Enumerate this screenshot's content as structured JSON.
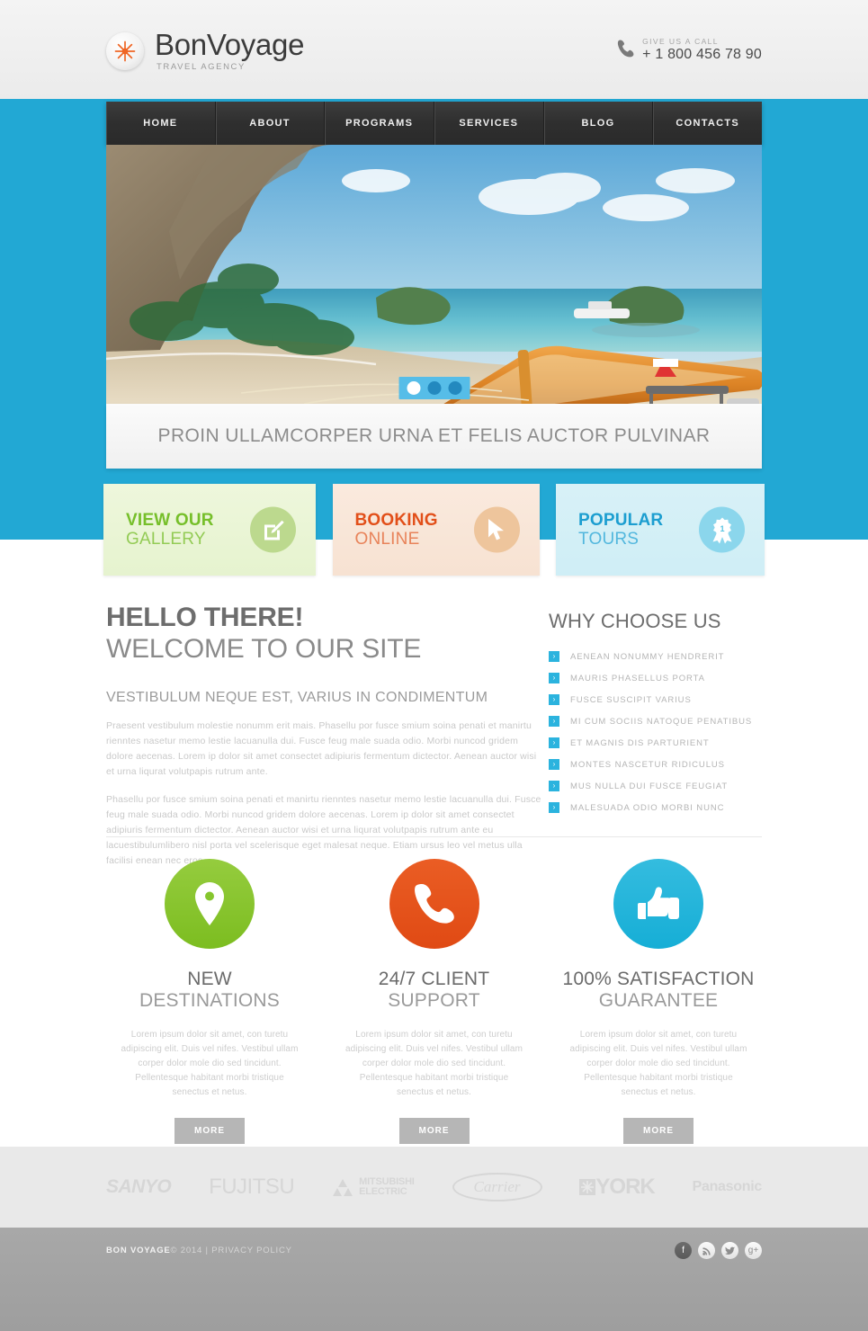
{
  "header": {
    "logo": {
      "name_bold": "Bon",
      "name_light": "Voyage",
      "tagline": "TRAVEL AGENCY",
      "icon": "starburst-icon"
    },
    "phone": {
      "label": "GIVE US A CALL",
      "number": "+ 1 800 456 78 90",
      "icon": "phone-icon"
    }
  },
  "nav": {
    "items": [
      {
        "label": "HOME"
      },
      {
        "label": "ABOUT"
      },
      {
        "label": "PROGRAMS"
      },
      {
        "label": "SERVICES"
      },
      {
        "label": "BLOG"
      },
      {
        "label": "CONTACTS"
      }
    ]
  },
  "slider": {
    "caption": "PROIN ULLAMCORPER URNA ET FELIS  AUCTOR PULVINAR",
    "dots": [
      {
        "active": true
      },
      {
        "active": false
      },
      {
        "active": false
      }
    ],
    "image_alt": "long-tail boat on tropical beach with limestone cliffs"
  },
  "promos": [
    {
      "line1": "VIEW OUR",
      "line2": "GALLERY",
      "icon": "pencil-edit-icon",
      "color": "#76bf2a"
    },
    {
      "line1": "BOOKING",
      "line2": "ONLINE",
      "icon": "cursor-arrow-icon",
      "color": "#e24f19"
    },
    {
      "line1": "POPULAR",
      "line2": "TOURS",
      "icon": "award-ribbon-icon",
      "badge_number": "1",
      "color": "#1c9ed0"
    }
  ],
  "intro": {
    "heading_bold": "HELLO THERE!",
    "heading_light": "WELCOME TO OUR SITE",
    "subheading": "VESTIBULUM NEQUE EST, VARIUS IN CONDIMENTUM",
    "paragraph1": "Praesent vestibulum molestie nonumm erit mais. Phasellu por fusce smium soina penati et manirtu rienntes nasetur memo lestie lacuanulla dui. Fusce feug male suada odio. Morbi nuncod gridem dolore aecenas. Lorem ip dolor sit amet consectet adipiuris fermentum dictector. Aenean auctor wisi et urna liqurat volutpapis rutrum ante.",
    "paragraph2": "Phasellu por fusce smium soina penati et manirtu rienntes nasetur memo lestie lacuanulla dui. Fusce feug male suada odio. Morbi nuncod gridem dolore aecenas. Lorem ip dolor sit amet consectet adipiuris fermentum dictector. Aenean auctor wisi et urna liqurat volutpapis rutrum ante eu lacuestibulumlibero nisl porta vel scelerisque eget malesat neque. Etiam ursus leo vel metus ulla facilisi enean nec eros."
  },
  "why_choose_us": {
    "title": "WHY CHOOSE US",
    "bullet_icon": "chevron-right-icon",
    "bullet_glyph": "›",
    "items": [
      {
        "label": "AENEAN NONUMMY HENDRERIT"
      },
      {
        "label": "MAURIS PHASELLUS PORTA"
      },
      {
        "label": "FUSCE SUSCIPIT VARIUS"
      },
      {
        "label": "MI CUM SOCIIS NATOQUE PENATIBUS"
      },
      {
        "label": "ET MAGNIS DIS PARTURIENT"
      },
      {
        "label": "MONTES NASCETUR RIDICULUS"
      },
      {
        "label": "MUS NULLA DUI FUSCE FEUGIAT"
      },
      {
        "label": " MALESUADA ODIO MORBI NUNC"
      }
    ]
  },
  "features": [
    {
      "icon": "map-pin-icon",
      "color": "#7cbd20",
      "title1": "NEW",
      "title2": "DESTINATIONS",
      "text": "Lorem ipsum dolor sit amet, con turetu adipiscing elit. Duis vel nifes. Vestibul ullam corper dolor mole dio sed tincidunt. Pellentesque habitant morbi tristique senectus et netus.",
      "button": "MORE"
    },
    {
      "icon": "phone-handset-icon",
      "color": "#e04a14",
      "title1": "24/7 CLIENT",
      "title2": "SUPPORT",
      "text": "Lorem ipsum dolor sit amet, con turetu adipiscing elit. Duis vel nifes. Vestibul ullam corper dolor mole dio sed tincidunt. Pellentesque habitant morbi tristique senectus et netus.",
      "button": "MORE"
    },
    {
      "icon": "thumbs-up-icon",
      "color": "#16aed6",
      "title1": "100% SATISFACTION",
      "title2": "GUARANTEE",
      "text": "Lorem ipsum dolor sit amet, con turetu adipiscing elit. Duis vel nifes. Vestibul ullam corper dolor mole dio sed tincidunt. Pellentesque habitant morbi tristique senectus et netus.",
      "button": "MORE"
    }
  ],
  "partners": [
    {
      "name": "SANYO"
    },
    {
      "name": "FUJITSU"
    },
    {
      "name": "MITSUBISHI",
      "name2": "ELECTRIC"
    },
    {
      "name": "Carrier"
    },
    {
      "name": "YORK"
    },
    {
      "name": "Panasonic"
    }
  ],
  "footer": {
    "brand": "BON VOYAGE",
    "copyright": "© 2014  |  ",
    "privacy": "PRIVACY POLICY",
    "socials": [
      {
        "icon": "facebook-icon",
        "glyph": "f",
        "active": true
      },
      {
        "icon": "rss-icon",
        "glyph": "⌁",
        "active": false
      },
      {
        "icon": "twitter-icon",
        "glyph": "t",
        "active": false
      },
      {
        "icon": "google-plus-icon",
        "glyph": "g+",
        "active": false
      }
    ]
  }
}
